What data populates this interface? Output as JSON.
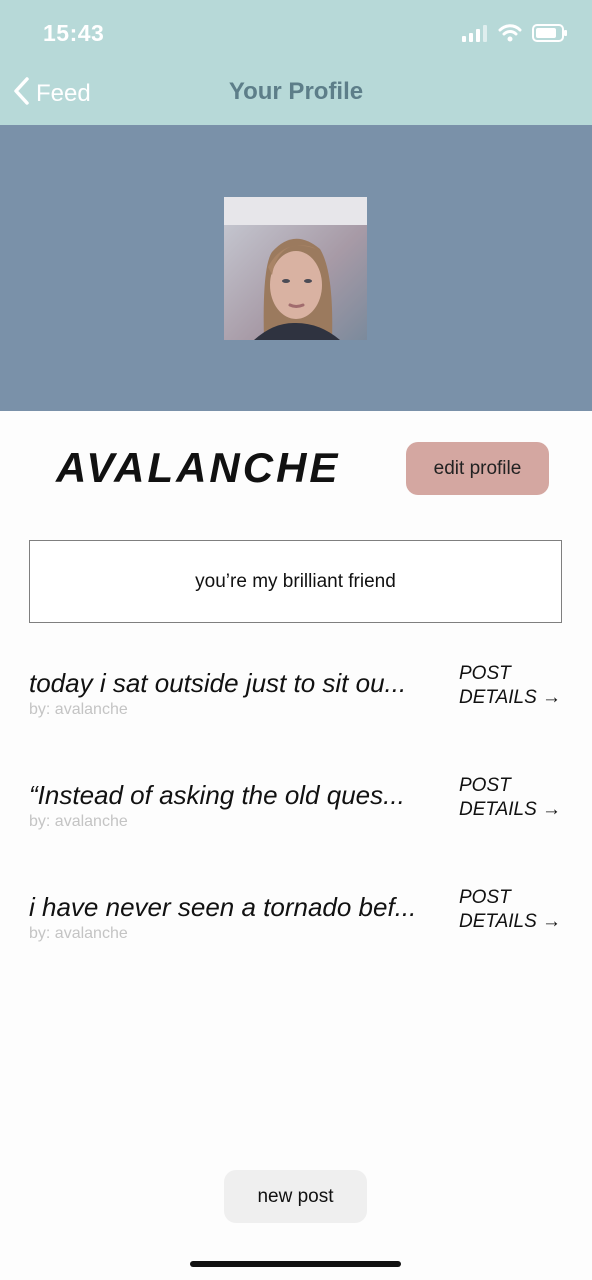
{
  "status_bar": {
    "time": "15:43",
    "icons": [
      "cellular-signal-icon",
      "wifi-icon",
      "battery-icon"
    ]
  },
  "nav": {
    "back_label": "Feed",
    "title": "Your Profile"
  },
  "profile": {
    "username": "AVALANCHE",
    "edit_label": "edit profile",
    "bio": "you’re my brilliant friend"
  },
  "posts": [
    {
      "title": "today i sat outside just to sit ou...",
      "by": "by: avalanche",
      "details_label_1": "POST",
      "details_label_2": "DETAILS →"
    },
    {
      "title": "“Instead of asking the old ques...",
      "by": "by: avalanche",
      "details_label_1": "POST",
      "details_label_2": "DETAILS →"
    },
    {
      "title": "i have never seen a tornado bef...",
      "by": "by: avalanche",
      "details_label_1": "POST",
      "details_label_2": "DETAILS →"
    }
  ],
  "actions": {
    "new_post_label": "new post"
  },
  "colors": {
    "header_bg": "#b7d9d8",
    "banner_bg": "#7a91a9",
    "edit_button_bg": "#d4a7a1",
    "new_post_bg": "#efefef",
    "nav_title": "#5d7e89"
  }
}
